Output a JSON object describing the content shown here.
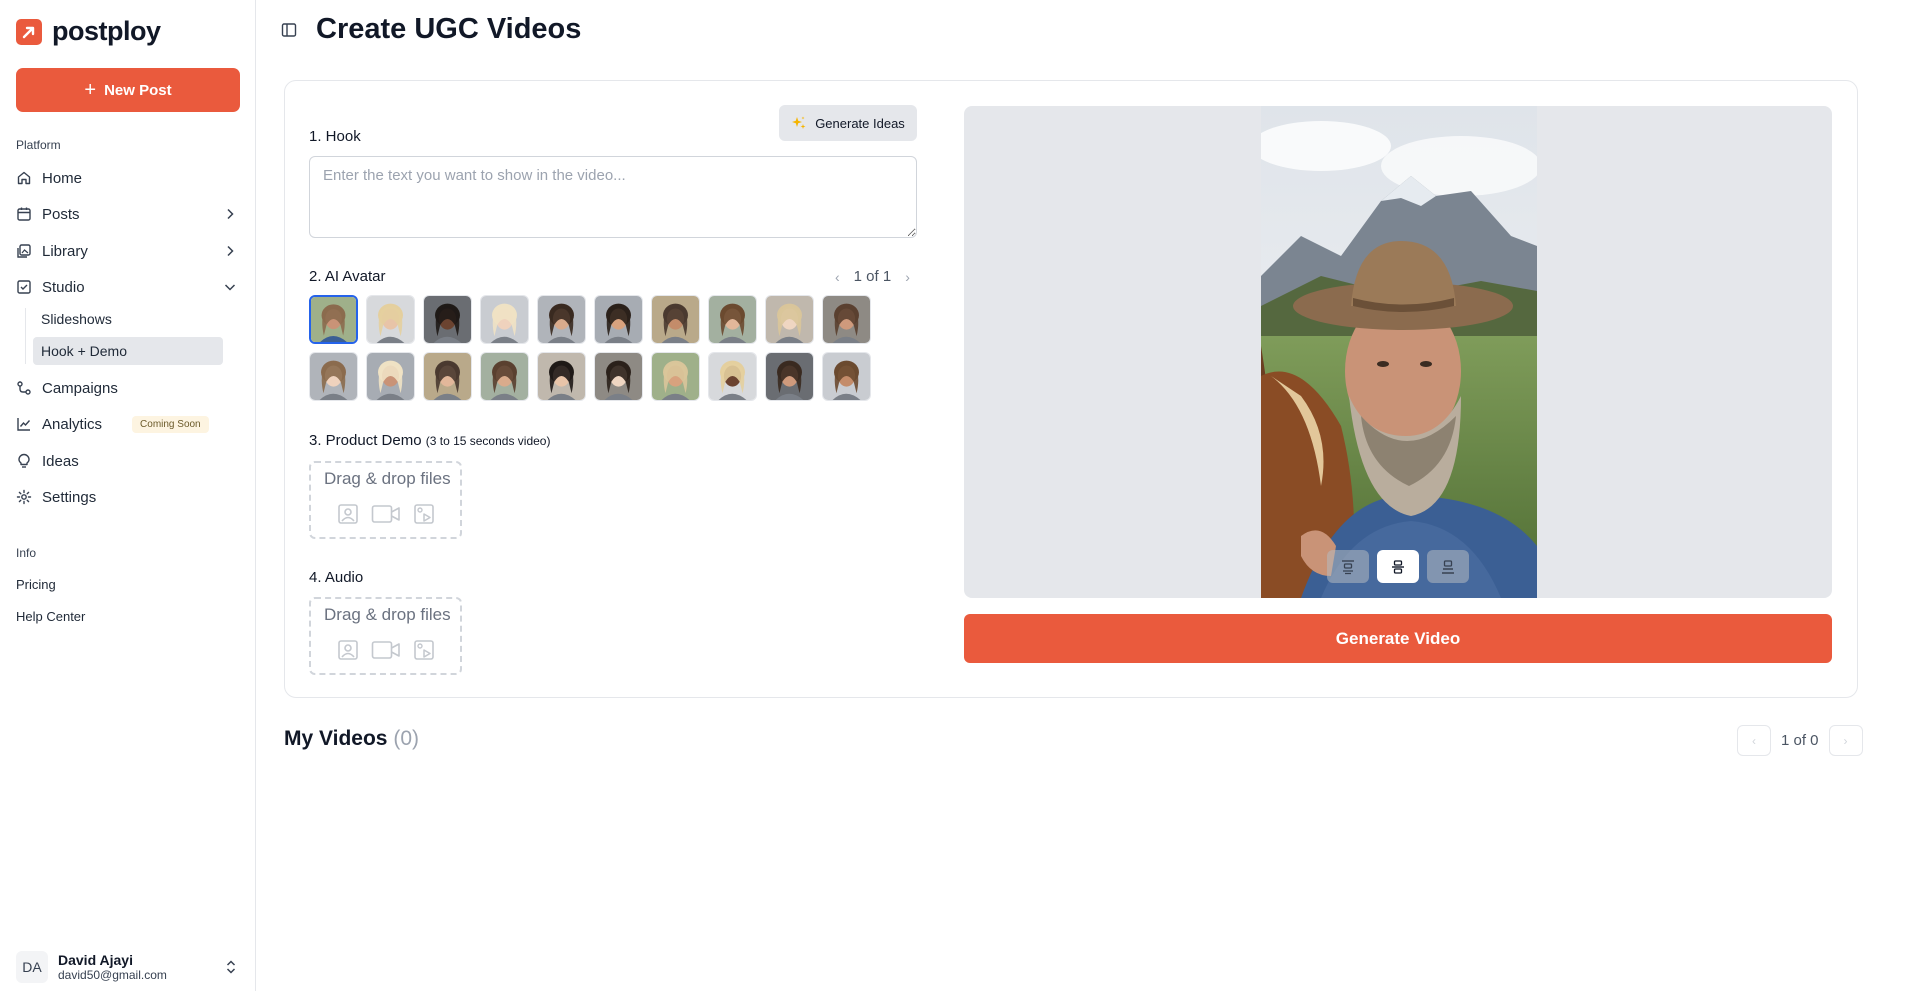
{
  "brand": {
    "name": "postploy",
    "accent": "#ea5a3d"
  },
  "sidebar": {
    "new_post_label": "New Post",
    "platform_label": "Platform",
    "items": [
      {
        "label": "Home",
        "icon": "home-icon"
      },
      {
        "label": "Posts",
        "icon": "calendar-icon"
      },
      {
        "label": "Library",
        "icon": "library-icon"
      },
      {
        "label": "Studio",
        "icon": "studio-icon",
        "expanded": true
      },
      {
        "label": "Campaigns",
        "icon": "campaigns-icon"
      },
      {
        "label": "Analytics",
        "icon": "chart-icon",
        "badge": "Coming Soon"
      },
      {
        "label": "Ideas",
        "icon": "lightbulb-icon"
      },
      {
        "label": "Settings",
        "icon": "gear-icon"
      }
    ],
    "studio_sub": [
      {
        "label": "Slideshows"
      },
      {
        "label": "Hook + Demo",
        "active": true
      }
    ],
    "info_label": "Info",
    "info_links": [
      "Pricing",
      "Help Center"
    ],
    "user": {
      "initials": "DA",
      "name": "David Ajayi",
      "email": "david50@gmail.com"
    }
  },
  "main": {
    "title": "Create UGC Videos",
    "hook": {
      "label": "1. Hook",
      "placeholder": "Enter the text you want to show in the video...",
      "generate_ideas_label": "Generate Ideas"
    },
    "avatar": {
      "label": "2. AI Avatar",
      "pager": "1 of 1",
      "selected_index": 0,
      "count": 20
    },
    "product_demo": {
      "label": "3. Product Demo",
      "hint": "(3 to 15 seconds video)",
      "drop_text": "Drag & drop files"
    },
    "audio": {
      "label": "4. Audio",
      "drop_text": "Drag & drop files"
    },
    "generate_video_label": "Generate Video",
    "my_videos": {
      "title": "My Videos",
      "count": "(0)",
      "pager": "1 of 0"
    }
  }
}
